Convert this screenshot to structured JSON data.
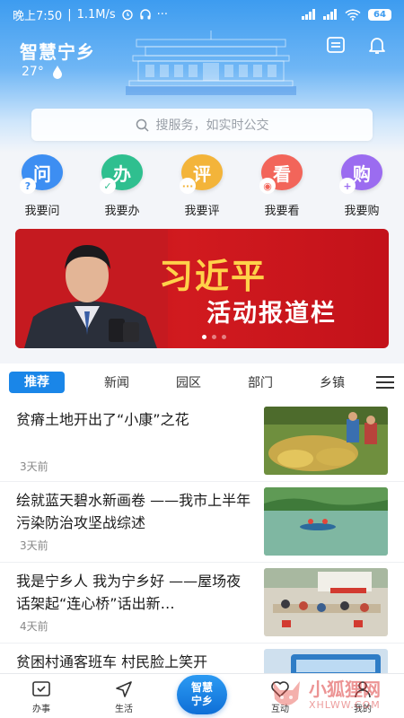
{
  "status_bar": {
    "time": "晚上7:50",
    "speed": "1.1M/s",
    "battery": "64"
  },
  "header": {
    "title": "智慧宁乡",
    "temperature": "27°"
  },
  "search": {
    "placeholder": "搜服务，如实时公交"
  },
  "quick_actions": [
    {
      "badge": "问",
      "label": "我要问",
      "color": "#3d8ef2"
    },
    {
      "badge": "办",
      "label": "我要办",
      "color": "#2fbf8f"
    },
    {
      "badge": "评",
      "label": "我要评",
      "color": "#f3b43a"
    },
    {
      "badge": "看",
      "label": "我要看",
      "color": "#f2655a"
    },
    {
      "badge": "购",
      "label": "我要购",
      "color": "#9b6cf0"
    }
  ],
  "banner": {
    "title_line1": "习近平",
    "title_line2": "活动报道栏"
  },
  "tabs": [
    "推荐",
    "新闻",
    "园区",
    "部门",
    "乡镇"
  ],
  "news": [
    {
      "title": "贫瘠土地开出了“小康”之花",
      "time": "3天前"
    },
    {
      "title": "绘就蓝天碧水新画卷 ——我市上半年污染防治攻坚战综述",
      "time": "3天前"
    },
    {
      "title": "我是宁乡人 我为宁乡好 ——屋场夜话架起“连心桥”话出新…",
      "time": "4天前"
    },
    {
      "title": "贫困村通客班车 村民脸上笑开",
      "time": ""
    }
  ],
  "bottom_nav": {
    "item1": "办事",
    "item2": "生活",
    "center_line1": "智慧",
    "center_line2": "宁乡",
    "item3": "互动",
    "item4": "我的"
  },
  "watermark": {
    "text": "小狐狸网",
    "sub": "XHLWW.COM"
  },
  "colors": {
    "accent": "#1a86e8",
    "banner_red": "#c3121a",
    "banner_gold": "#ffd24a"
  }
}
